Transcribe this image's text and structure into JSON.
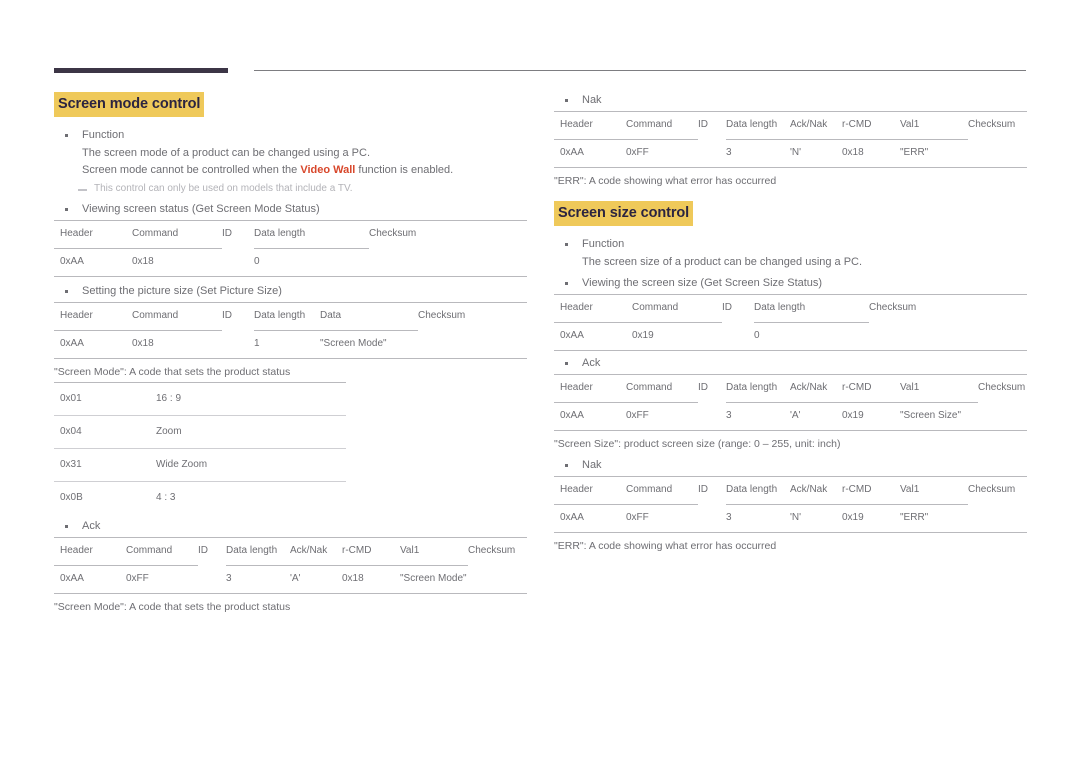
{
  "document": {
    "title": "Screen mode and screen size control reference"
  },
  "decor": {
    "bar_color": "#3c3546",
    "rule_color": "#7d7d81",
    "highlight_color": "#efc95a",
    "heading_text_color": "#2b2440",
    "accent_red": "#d8472b"
  },
  "left": {
    "heading": "Screen mode control",
    "function_bullet": "Function",
    "function_line1": "The screen mode of a product can be changed using a PC.",
    "function_line2_pre": "Screen mode cannot be controlled when the ",
    "function_line2_bold": "Video Wall",
    "function_line2_post": " function is enabled.",
    "note": "This control can only be used on models that include a TV.",
    "get_status_bullet": "Viewing screen status (Get Screen Mode Status)",
    "get_status_table": {
      "headers": [
        "Header",
        "Command",
        "ID",
        "Data length",
        "Checksum"
      ],
      "row": [
        "0xAA",
        "0x18",
        "",
        "0",
        ""
      ]
    },
    "set_size_bullet": "Setting the picture size (Set Picture Size)",
    "set_size_table": {
      "headers": [
        "Header",
        "Command",
        "ID",
        "Data length",
        "Data",
        "Checksum"
      ],
      "row": [
        "0xAA",
        "0x18",
        "",
        "1",
        "\"Screen Mode\"",
        ""
      ]
    },
    "screen_mode_caption": "\"Screen Mode\": A code that sets the product status",
    "screen_mode_codes": [
      [
        "0x01",
        "16 : 9"
      ],
      [
        "0x04",
        "Zoom"
      ],
      [
        "0x31",
        "Wide Zoom"
      ],
      [
        "0x0B",
        "4 : 3"
      ]
    ],
    "ack_bullet": "Ack",
    "ack_table": {
      "headers": [
        "Header",
        "Command",
        "ID",
        "Data length",
        "Ack/Nak",
        "r-CMD",
        "Val1",
        "Checksum"
      ],
      "row": [
        "0xAA",
        "0xFF",
        "",
        "3",
        "'A'",
        "0x18",
        "\"Screen Mode\"",
        ""
      ]
    },
    "ack_caption": "\"Screen Mode\": A code that sets the product status"
  },
  "right": {
    "nak_bullet_top": "Nak",
    "nak_table_top": {
      "headers": [
        "Header",
        "Command",
        "ID",
        "Data length",
        "Ack/Nak",
        "r-CMD",
        "Val1",
        "Checksum"
      ],
      "row": [
        "0xAA",
        "0xFF",
        "",
        "3",
        "'N'",
        "0x18",
        "\"ERR\"",
        ""
      ]
    },
    "nak_caption_top": "\"ERR\": A code showing what error has occurred",
    "heading": "Screen size control",
    "function_bullet": "Function",
    "function_line1": "The screen size of a product can be changed using a PC.",
    "get_size_bullet": "Viewing the screen size (Get Screen Size Status)",
    "get_size_table": {
      "headers": [
        "Header",
        "Command",
        "ID",
        "Data length",
        "Checksum"
      ],
      "row": [
        "0xAA",
        "0x19",
        "",
        "0",
        ""
      ]
    },
    "ack_bullet": "Ack",
    "ack_table": {
      "headers": [
        "Header",
        "Command",
        "ID",
        "Data length",
        "Ack/Nak",
        "r-CMD",
        "Val1",
        "Checksum"
      ],
      "row": [
        "0xAA",
        "0xFF",
        "",
        "3",
        "'A'",
        "0x19",
        "\"Screen Size\"",
        ""
      ]
    },
    "ack_caption": "\"Screen Size\": product screen size (range: 0 – 255, unit: inch)",
    "nak_bullet_bottom": "Nak",
    "nak_table_bottom": {
      "headers": [
        "Header",
        "Command",
        "ID",
        "Data length",
        "Ack/Nak",
        "r-CMD",
        "Val1",
        "Checksum"
      ],
      "row": [
        "0xAA",
        "0xFF",
        "",
        "3",
        "'N'",
        "0x19",
        "\"ERR\"",
        ""
      ]
    },
    "nak_caption_bottom": "\"ERR\": A code showing what error has occurred"
  }
}
